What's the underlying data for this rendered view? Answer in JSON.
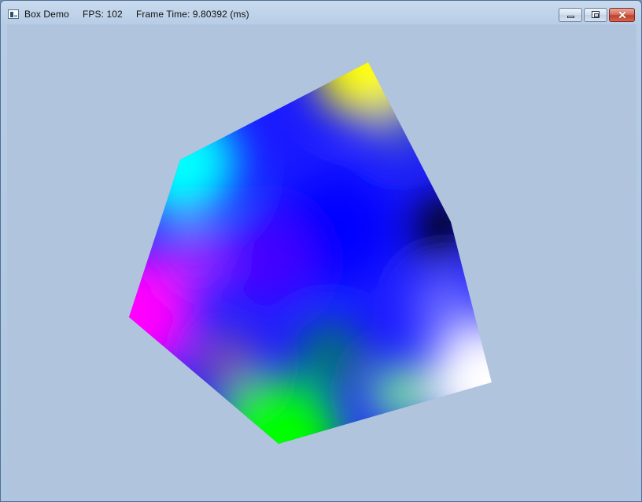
{
  "window": {
    "title": "Box Demo     FPS: 102     Frame Time: 9.80392 (ms)",
    "controls": {
      "minimize": "minimize-icon",
      "maximize": "maximize-icon",
      "close": "close-icon",
      "close_glyph": "✕"
    }
  },
  "scene": {
    "background_color": "#b0c4de",
    "vertex_colors": {
      "top": "#ffff00",
      "left_upper": "#00ffff",
      "left": "#ff00ff",
      "bottom": "#00ff00",
      "right_lower": "#ffffff",
      "right_upper": "#000000",
      "center": "#0000ff"
    }
  }
}
